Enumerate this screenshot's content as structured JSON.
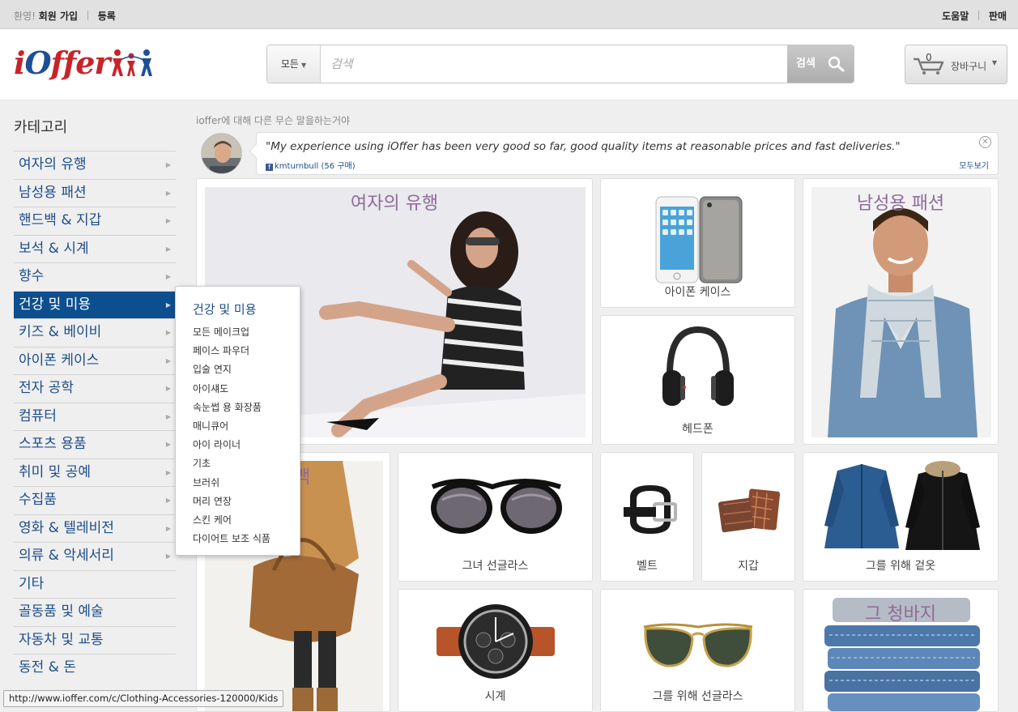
{
  "topbar": {
    "welcome": "환영!",
    "join": "회원 가입",
    "register": "등록",
    "help": "도움말",
    "sell": "판매"
  },
  "header": {
    "logo_text_i": "i",
    "logo_text_o": "O",
    "logo_text_rest": "ffer",
    "search_category": "모든",
    "search_placeholder": "검색",
    "search_button": "검색",
    "cart_count": "0",
    "cart_label": "장바구니"
  },
  "sidebar": {
    "title": "카테고리",
    "items": [
      {
        "label": "여자의 유행",
        "has_sub": true
      },
      {
        "label": "남성용 패션",
        "has_sub": true
      },
      {
        "label": "핸드백 & 지갑",
        "has_sub": true
      },
      {
        "label": "보석 & 시계",
        "has_sub": true
      },
      {
        "label": "향수",
        "has_sub": true
      },
      {
        "label": "건강 및 미용",
        "has_sub": true,
        "active": true
      },
      {
        "label": "키즈 & 베이비",
        "has_sub": true
      },
      {
        "label": "아이폰 케이스",
        "has_sub": true
      },
      {
        "label": "전자 공학",
        "has_sub": true
      },
      {
        "label": "컴퓨터",
        "has_sub": true
      },
      {
        "label": "스포츠 용품",
        "has_sub": true
      },
      {
        "label": "취미 및 공예",
        "has_sub": true
      },
      {
        "label": "수집품",
        "has_sub": true
      },
      {
        "label": "영화 & 텔레비전",
        "has_sub": true
      },
      {
        "label": "의류 & 악세서리",
        "has_sub": true
      },
      {
        "label": "기타",
        "has_sub": false
      },
      {
        "label": "골동품 및 예술",
        "has_sub": false
      },
      {
        "label": "자동차 및 교통",
        "has_sub": false
      },
      {
        "label": "동전 & 돈",
        "has_sub": false
      }
    ]
  },
  "flyout": {
    "title": "건강 및 미용",
    "items": [
      "모든 메이크업",
      "페이스 파우더",
      "입술 연지",
      "아이섀도",
      "속눈썹 용 화장품",
      "매니큐어",
      "아이 라이너",
      "기초",
      "브러쉬",
      "머리 연장",
      "스킨 케어",
      "다이어트 보조 식품"
    ]
  },
  "testimonial": {
    "tagline": "ioffer에 대해 다른 무슨 말을하는거야",
    "quote": "\"My experience using iOffer has been very good so far, good quality items at reasonable prices and fast deliveries.\"",
    "fb_glyph": "f",
    "author": "kmturnbull (56 구매)",
    "see_all": "모두보기",
    "close_glyph": "✕"
  },
  "tiles": {
    "womens": "여자의 유행",
    "iphone": "아이폰 케이스",
    "mens": "남성용 패션",
    "headphones": "헤드폰",
    "handbag": "백",
    "sunglasses_her": "그녀 선글라스",
    "belt": "벨트",
    "wallet": "지갑",
    "outerwear": "그를 위해 겉옷",
    "watch": "시계",
    "sunglasses_him": "그를 위해 선글라스",
    "jeans": "그 청바지"
  },
  "statusbar": {
    "url": "http://www.ioffer.com/c/Clothing-Accessories-120000/Kids"
  },
  "colors": {
    "brand_red": "#c7242a",
    "brand_blue": "#1e4f96",
    "link_blue": "#1c4d8a",
    "active_bg": "#0d4f8e"
  }
}
